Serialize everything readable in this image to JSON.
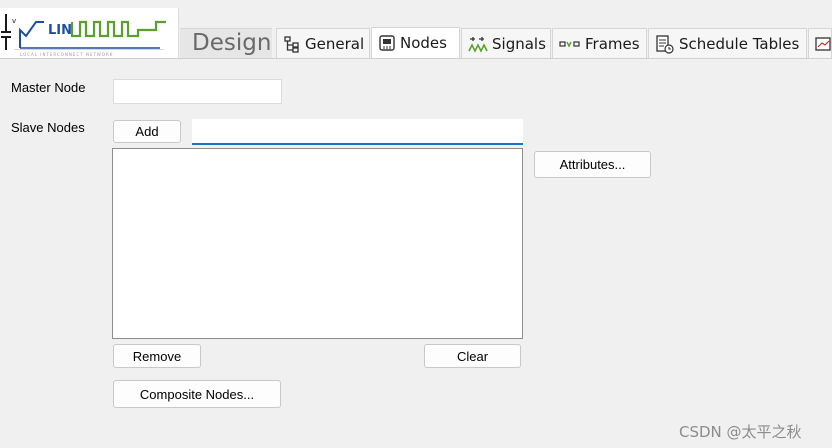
{
  "logo": {
    "name": "LIN",
    "tagline": "LOCAL INTERCONNECT NETWORK",
    "brand_color": "#1e4fa0",
    "signal_color": "#5aa02c"
  },
  "tabs": {
    "design": "Design",
    "items": [
      {
        "label": "General",
        "icon": "tree-icon",
        "active": false
      },
      {
        "label": "Nodes",
        "icon": "node-chip-icon",
        "active": true
      },
      {
        "label": "Signals",
        "icon": "signal-wave-icon",
        "active": false
      },
      {
        "label": "Frames",
        "icon": "frames-icon",
        "active": false
      },
      {
        "label": "Schedule Tables",
        "icon": "schedule-table-icon",
        "active": false
      }
    ]
  },
  "form": {
    "master_label": "Master Node",
    "master_value": "",
    "slave_label": "Slave Nodes",
    "add_button": "Add",
    "add_value": "",
    "attributes_button": "Attributes...",
    "slave_list": [],
    "remove_button": "Remove",
    "clear_button": "Clear",
    "composite_button": "Composite Nodes..."
  },
  "watermark": "CSDN @太平之秋",
  "colors": {
    "focus_underline": "#1a73c7",
    "background": "#f0f0f0"
  }
}
